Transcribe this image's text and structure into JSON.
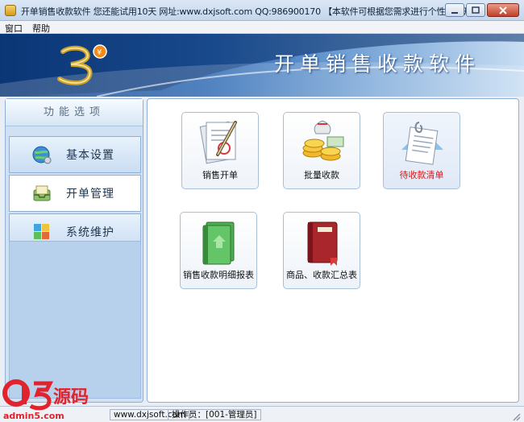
{
  "window": {
    "title": "开单销售收款软件   您还能试用10天   网址:www.dxjsoft.com   QQ:986900170   【本软件可根据您需求进行个性定制开发】"
  },
  "menu": {
    "items": [
      "窗口",
      "帮助"
    ]
  },
  "banner": {
    "title": "开单销售收款软件"
  },
  "sidebar": {
    "heading": "功能选项",
    "items": [
      {
        "label": "基本设置",
        "icon": "globe-settings-icon"
      },
      {
        "label": "开单管理",
        "icon": "inbox-tray-icon",
        "active": true
      },
      {
        "label": "系统维护",
        "icon": "puzzle-maintenance-icon"
      }
    ]
  },
  "main": {
    "tiles": [
      {
        "label": "销售开单",
        "icon": "document-pen-icon"
      },
      {
        "label": "批量收款",
        "icon": "coins-money-icon"
      },
      {
        "label": "待收款清单",
        "icon": "clipboard-list-icon",
        "highlight": true
      },
      {
        "label": "销售收款明细报表",
        "icon": "green-book-icon"
      },
      {
        "label": "商品、收款汇总表",
        "icon": "red-book-icon"
      }
    ]
  },
  "status": {
    "website": "www.dxjsoft.com",
    "operator": "操作员：[001-管理员]"
  },
  "watermark": {
    "brand": "源码",
    "domain": "admin5.com"
  },
  "colors": {
    "accent": "#2b68b3",
    "highlight_text": "#d41a1a"
  }
}
